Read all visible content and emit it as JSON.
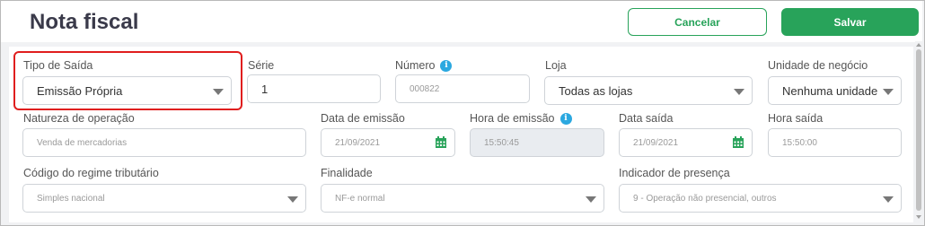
{
  "header": {
    "title": "Nota fiscal",
    "cancel_label": "Cancelar",
    "save_label": "Salvar"
  },
  "colors": {
    "accent": "#28a35a",
    "info": "#2ba8e0",
    "highlight": "#e01e1e"
  },
  "icons": {
    "info": "info-icon",
    "calendar": "calendar-icon",
    "dropdown": "chevron-down-icon"
  },
  "form": {
    "tipo_saida": {
      "label": "Tipo de Saída",
      "value": "Emissão Própria"
    },
    "serie": {
      "label": "Série",
      "value": "1"
    },
    "numero": {
      "label": "Número",
      "placeholder": "000822"
    },
    "loja": {
      "label": "Loja",
      "value": "Todas as lojas"
    },
    "unidade": {
      "label": "Unidade de negócio",
      "value": "Nenhuma unidade"
    },
    "natureza": {
      "label": "Natureza de operação",
      "placeholder": "Venda de mercadorias"
    },
    "data_emissao": {
      "label": "Data de emissão",
      "placeholder": "21/09/2021"
    },
    "hora_emissao": {
      "label": "Hora de emissão",
      "value": "15:50:45"
    },
    "data_saida": {
      "label": "Data saída",
      "placeholder": "21/09/2021"
    },
    "hora_saida": {
      "label": "Hora saída",
      "placeholder": "15:50:00"
    },
    "regime": {
      "label": "Código do regime tributário",
      "placeholder": "Simples nacional"
    },
    "finalidade": {
      "label": "Finalidade",
      "placeholder": "NF-e normal"
    },
    "presenca": {
      "label": "Indicador de presença",
      "placeholder": "9 - Operação não presencial, outros"
    }
  }
}
